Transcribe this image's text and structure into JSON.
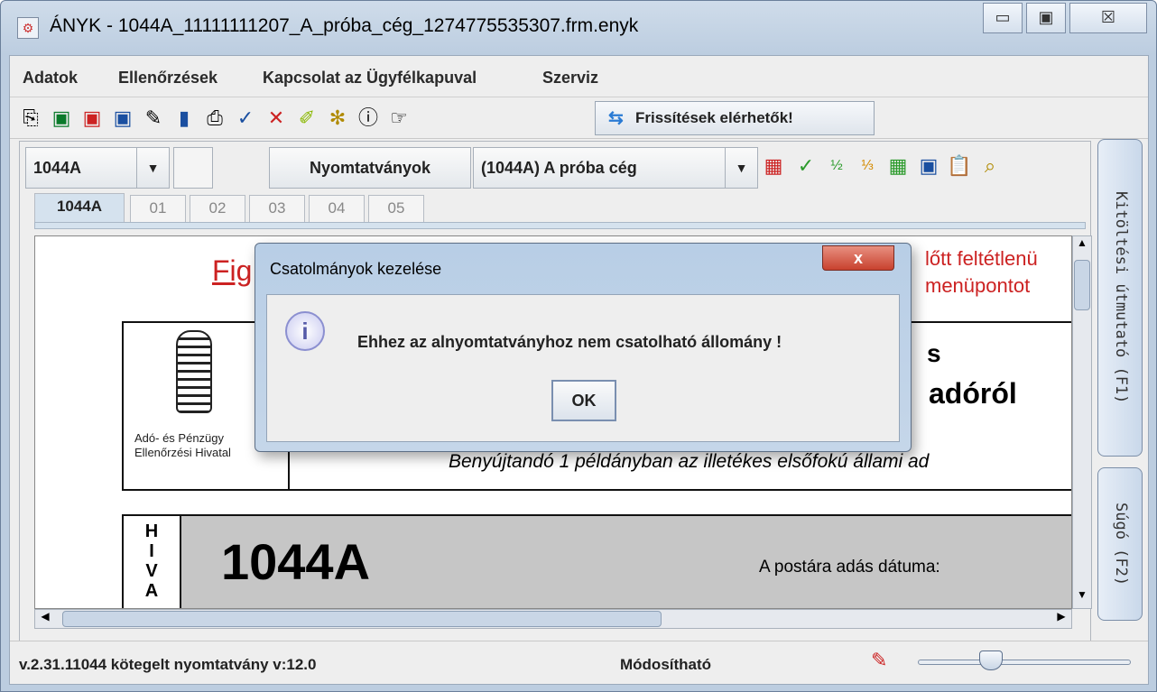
{
  "window": {
    "title": "ÁNYK - 1044A_11111111207_A_próba_cég_1274775535307.frm.enyk",
    "minimize": "▭",
    "maximize": "▣",
    "close": "☒"
  },
  "menu": [
    "Adatok",
    "Ellenőrzések",
    "Kapcsolat az Ügyfélkapuval",
    "Szerviz"
  ],
  "toolbar": {
    "update_label": "Frissítések elérhetők!"
  },
  "form": {
    "combo_value": "1044A",
    "forms_button": "Nyomtatványok",
    "company_combo": "(1044A) A próba cég",
    "tabs": [
      "1044A",
      "01",
      "02",
      "03",
      "04",
      "05"
    ],
    "doc": {
      "red_left": "Fig",
      "red_right_1": "lőtt feltétlenü",
      "red_right_2": "menüpontot",
      "office_1": "Adó- és Pénzügy",
      "office_2": "Ellenőrzési Hivatal",
      "big_text": "adóról",
      "submit_text": "Benyújtandó 1 példányban az illetékes elsőfokú állami ad",
      "side_letters": "H\nI\nV\nA",
      "form_code": "1044A",
      "postal_date": "A postára adás dátuma:",
      "s_letter": "s"
    }
  },
  "side_buttons": {
    "guide": "Kitöltési útmutató (F1)",
    "help": "Súgó (F2)"
  },
  "status": {
    "version": "v.2.31.11044 kötegelt nyomtatvány v:12.0",
    "mode": "Módosítható"
  },
  "dialog": {
    "title": "Csatolmányok kezelése",
    "message": "Ehhez az alnyomtatványhoz nem csatolható állomány !",
    "ok": "OK",
    "close": "x",
    "info_icon": "i"
  }
}
